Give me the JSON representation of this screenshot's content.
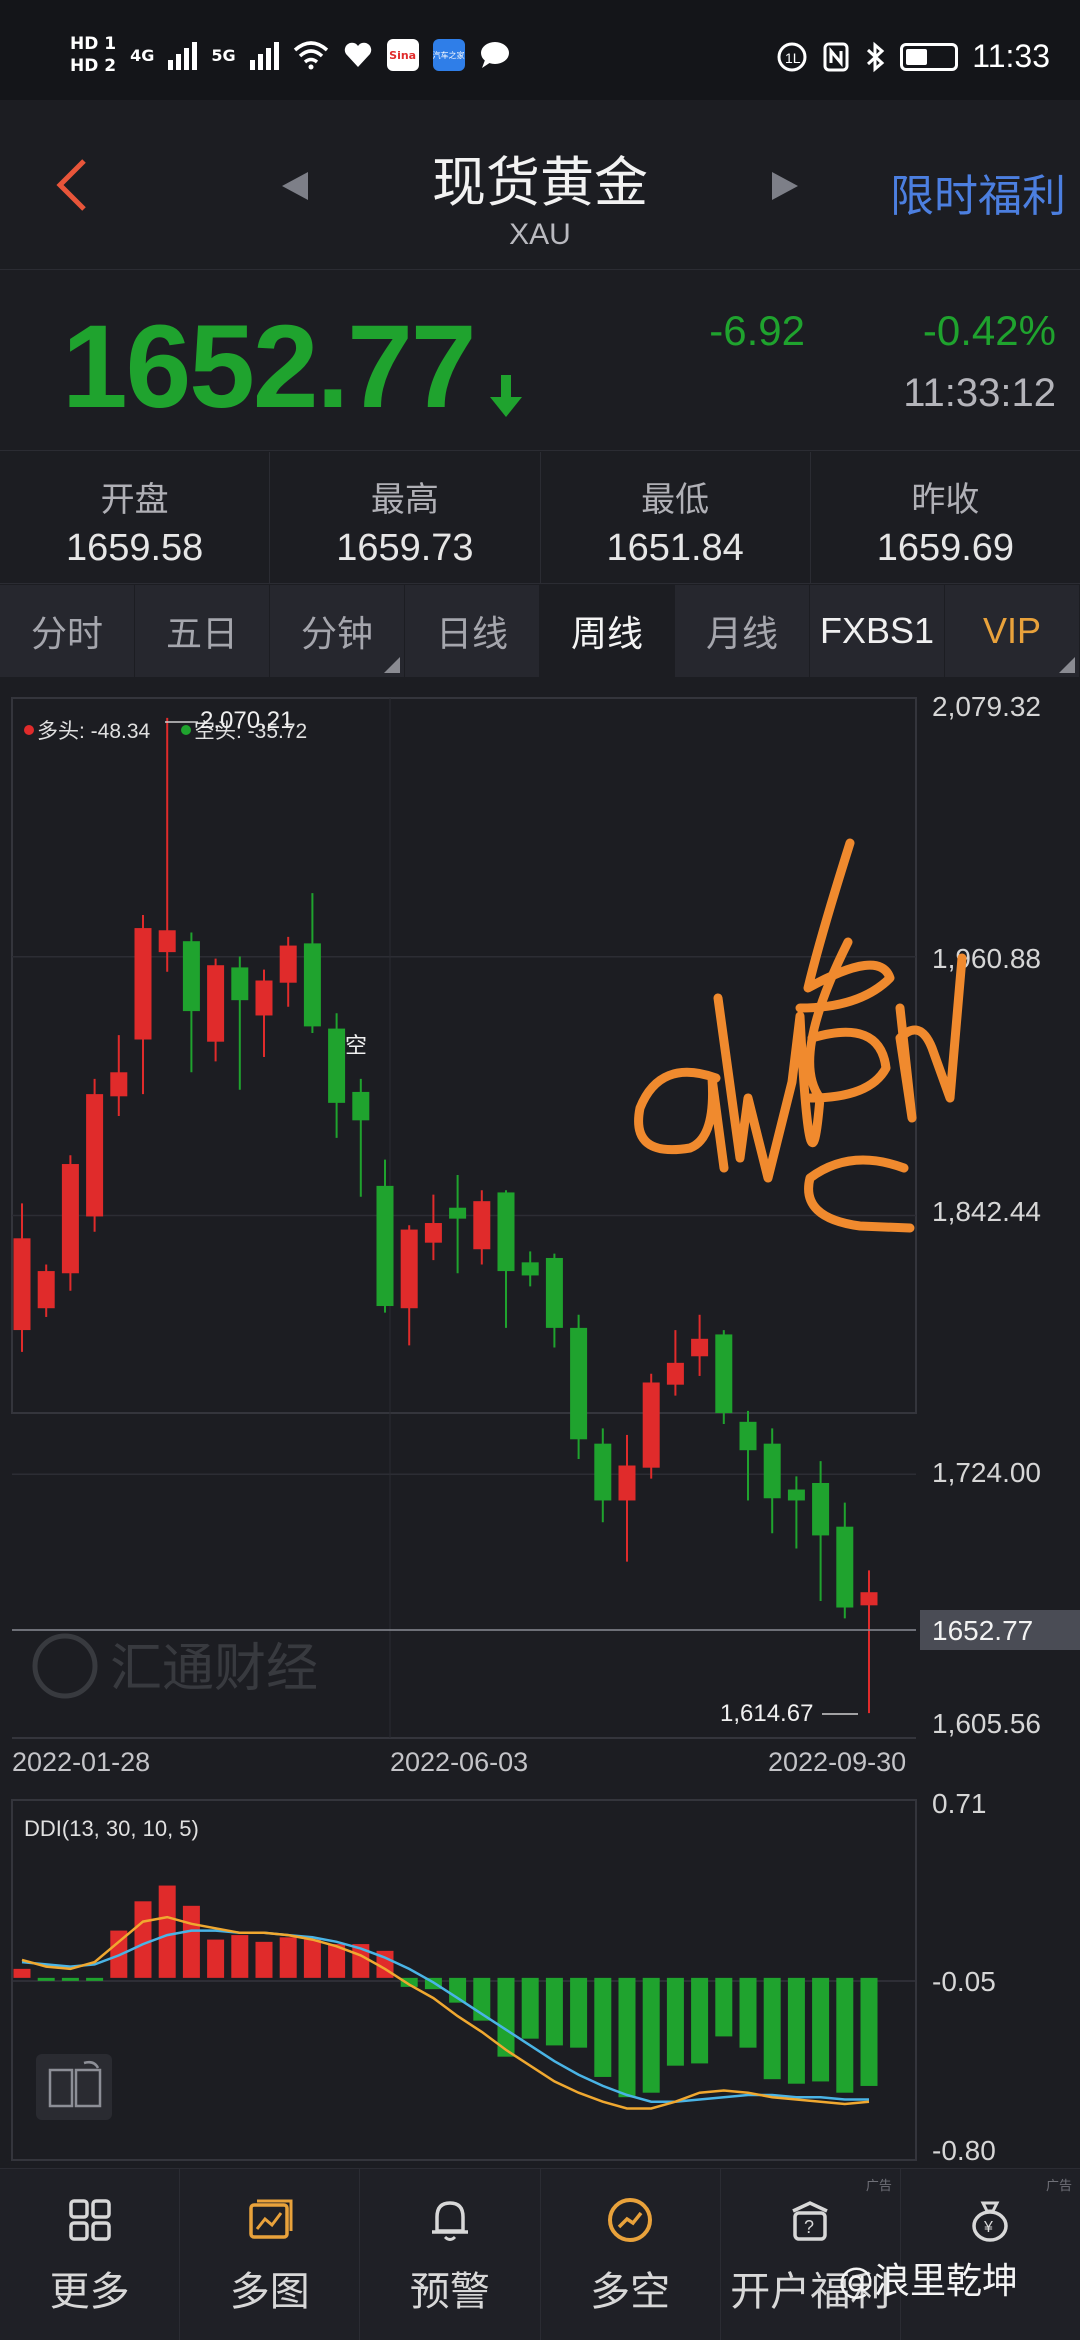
{
  "status_bar": {
    "hd1": "HD 1",
    "hd2": "HD 2",
    "net1": "4G",
    "net2": "5G",
    "app_sina": "Sina",
    "app_car": "汽车之家",
    "time": "11:33",
    "battery_level": 0.45
  },
  "header": {
    "title": "现货黄金",
    "subtitle": "XAU",
    "promo": "限时福利"
  },
  "quote": {
    "price": "1652.77",
    "change": "-6.92",
    "change_pct": "-0.42%",
    "time": "11:33:12",
    "color_down": "#1fa32e",
    "color_up": "#e02b2b"
  },
  "stats": [
    {
      "label": "开盘",
      "value": "1659.58"
    },
    {
      "label": "最高",
      "value": "1659.73"
    },
    {
      "label": "最低",
      "value": "1651.84"
    },
    {
      "label": "昨收",
      "value": "1659.69"
    }
  ],
  "tabs": [
    {
      "label": "分时"
    },
    {
      "label": "五日"
    },
    {
      "label": "分钟"
    },
    {
      "label": "日线"
    },
    {
      "label": "周线"
    },
    {
      "label": "月线"
    },
    {
      "label": "FXBS1"
    },
    {
      "label": "VIP"
    }
  ],
  "chart": {
    "indicator_long": "多头: -48.34",
    "indicator_short": "空头: -35.72",
    "high_marker": "2,070.21",
    "low_marker": "1,614.67",
    "signal_label": "空",
    "watermark": "汇通财经",
    "y_labels": [
      "2,079.32",
      "1,960.88",
      "1,842.44",
      "1,724.00",
      "1,605.56"
    ],
    "current_price": "1652.77",
    "x_labels": [
      "2022-01-28",
      "2022-06-03",
      "2022-09-30"
    ],
    "ddi_title": "DDI(13, 30, 10, 5)",
    "ddi_y_labels": [
      "0.71",
      "-0.05",
      "-0.80"
    ],
    "handwriting": [
      "b",
      "a",
      "c"
    ]
  },
  "chart_data": {
    "type": "candlestick",
    "period": "weekly",
    "ylim": [
      1605.56,
      2079.32
    ],
    "candles": [
      {
        "o": 1790,
        "c": 1832,
        "h": 1848,
        "l": 1780
      },
      {
        "o": 1800,
        "c": 1817,
        "h": 1820,
        "l": 1796
      },
      {
        "o": 1816,
        "c": 1866,
        "h": 1870,
        "l": 1808
      },
      {
        "o": 1842,
        "c": 1898,
        "h": 1905,
        "l": 1835
      },
      {
        "o": 1897,
        "c": 1908,
        "h": 1925,
        "l": 1888
      },
      {
        "o": 1923,
        "c": 1974,
        "h": 1980,
        "l": 1898
      },
      {
        "o": 1963,
        "c": 1973,
        "h": 2070.21,
        "l": 1954
      },
      {
        "o": 1968,
        "c": 1936,
        "h": 1972,
        "l": 1908
      },
      {
        "o": 1922,
        "c": 1957,
        "h": 1960,
        "l": 1913
      },
      {
        "o": 1956,
        "c": 1941,
        "h": 1961,
        "l": 1900
      },
      {
        "o": 1934,
        "c": 1950,
        "h": 1955,
        "l": 1915
      },
      {
        "o": 1949,
        "c": 1966,
        "h": 1970,
        "l": 1938
      },
      {
        "o": 1967,
        "c": 1929,
        "h": 1990,
        "l": 1926
      },
      {
        "o": 1928,
        "c": 1894,
        "h": 1935,
        "l": 1878
      },
      {
        "o": 1899,
        "c": 1886,
        "h": 1905,
        "l": 1851
      },
      {
        "o": 1856,
        "c": 1801,
        "h": 1868,
        "l": 1798
      },
      {
        "o": 1800,
        "c": 1836,
        "h": 1838,
        "l": 1783
      },
      {
        "o": 1830,
        "c": 1839,
        "h": 1852,
        "l": 1822
      },
      {
        "o": 1846,
        "c": 1841,
        "h": 1861,
        "l": 1816
      },
      {
        "o": 1827,
        "c": 1849,
        "h": 1854,
        "l": 1820
      },
      {
        "o": 1853,
        "c": 1817,
        "h": 1854,
        "l": 1791
      },
      {
        "o": 1821,
        "c": 1815,
        "h": 1826,
        "l": 1810
      },
      {
        "o": 1823,
        "c": 1791,
        "h": 1825,
        "l": 1782
      },
      {
        "o": 1791,
        "c": 1740,
        "h": 1797,
        "l": 1731
      },
      {
        "o": 1738,
        "c": 1712,
        "h": 1745,
        "l": 1702
      },
      {
        "o": 1712,
        "c": 1728,
        "h": 1742,
        "l": 1684
      },
      {
        "o": 1727,
        "c": 1766,
        "h": 1770,
        "l": 1722
      },
      {
        "o": 1765,
        "c": 1775,
        "h": 1790,
        "l": 1760
      },
      {
        "o": 1778,
        "c": 1786,
        "h": 1797,
        "l": 1769
      },
      {
        "o": 1788,
        "c": 1752,
        "h": 1790,
        "l": 1747
      },
      {
        "o": 1748,
        "c": 1735,
        "h": 1753,
        "l": 1712
      },
      {
        "o": 1738,
        "c": 1713,
        "h": 1745,
        "l": 1697
      },
      {
        "o": 1717,
        "c": 1712,
        "h": 1723,
        "l": 1690
      },
      {
        "o": 1720,
        "c": 1696,
        "h": 1730,
        "l": 1666
      },
      {
        "o": 1700,
        "c": 1663,
        "h": 1711,
        "l": 1658
      },
      {
        "o": 1664,
        "c": 1670,
        "h": 1680,
        "l": 1614.67
      }
    ],
    "ddi_ylim": [
      -0.8,
      0.71
    ],
    "ddi_bars": [
      0.04,
      -0.01,
      -0.01,
      -0.01,
      0.21,
      0.34,
      0.41,
      0.32,
      0.17,
      0.19,
      0.16,
      0.18,
      0.17,
      0.15,
      0.15,
      0.12,
      -0.04,
      -0.05,
      -0.11,
      -0.19,
      -0.35,
      -0.27,
      -0.3,
      -0.31,
      -0.44,
      -0.53,
      -0.51,
      -0.39,
      -0.38,
      -0.26,
      -0.31,
      -0.45,
      -0.47,
      -0.46,
      -0.51,
      -0.48
    ],
    "ddi_line1": [
      0.08,
      0.05,
      0.04,
      0.07,
      0.16,
      0.25,
      0.27,
      0.24,
      0.22,
      0.2,
      0.2,
      0.19,
      0.17,
      0.14,
      0.1,
      0.04,
      -0.03,
      -0.09,
      -0.17,
      -0.24,
      -0.32,
      -0.39,
      -0.46,
      -0.51,
      -0.55,
      -0.58,
      -0.58,
      -0.55,
      -0.51,
      -0.5,
      -0.51,
      -0.53,
      -0.54,
      -0.55,
      -0.56,
      -0.55
    ],
    "ddi_line2": [
      0.07,
      0.06,
      0.05,
      0.06,
      0.1,
      0.15,
      0.19,
      0.21,
      0.21,
      0.2,
      0.2,
      0.19,
      0.18,
      0.16,
      0.13,
      0.09,
      0.04,
      -0.02,
      -0.09,
      -0.16,
      -0.23,
      -0.3,
      -0.37,
      -0.43,
      -0.48,
      -0.52,
      -0.55,
      -0.55,
      -0.54,
      -0.53,
      -0.52,
      -0.52,
      -0.53,
      -0.53,
      -0.54,
      -0.54
    ]
  },
  "bottom_nav": [
    {
      "label": "更多",
      "icon": "grid-icon"
    },
    {
      "label": "多图",
      "icon": "chart-image-icon"
    },
    {
      "label": "预警",
      "icon": "bell-icon"
    },
    {
      "label": "多空",
      "icon": "trend-icon"
    },
    {
      "label": "开户福利",
      "icon": "gift-box-icon"
    },
    {
      "label": "",
      "icon": "money-bag-icon"
    }
  ],
  "bottom_watermark": "@浪里乾坤"
}
